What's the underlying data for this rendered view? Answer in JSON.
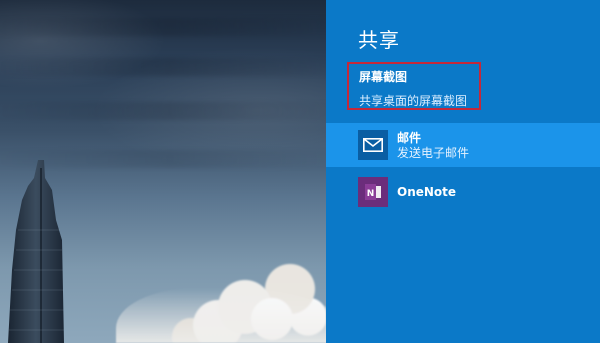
{
  "share": {
    "title": "共享",
    "screenshot": {
      "title": "屏幕截图",
      "subtitle": "共享桌面的屏幕截图"
    },
    "apps": [
      {
        "name": "邮件",
        "description": "发送电子邮件",
        "icon": "mail-icon"
      },
      {
        "name": "OneNote",
        "description": "",
        "icon": "onenote-icon"
      }
    ]
  },
  "colors": {
    "panel_bg": "#0b79c8",
    "selected_bg": "#1b94ea",
    "highlight_border": "#c5283a",
    "mail_icon_bg": "#0a5ea3",
    "onenote_icon_bg": "#6b2d7b"
  }
}
